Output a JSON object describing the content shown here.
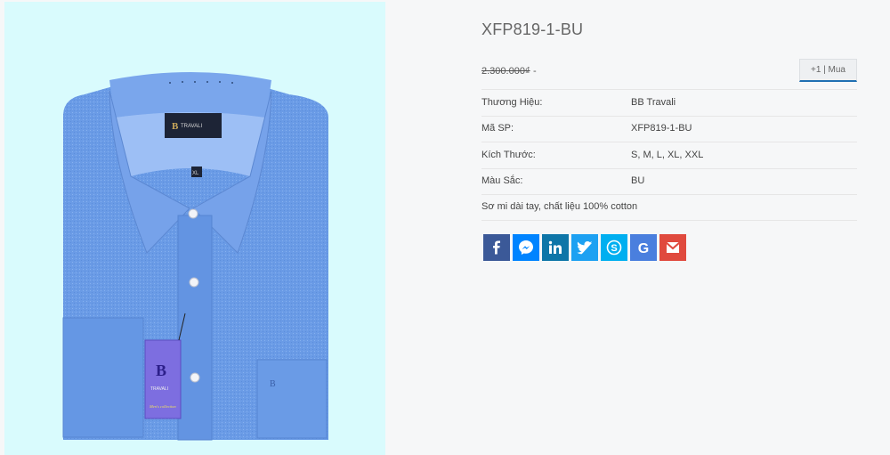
{
  "product": {
    "title": "XFP819-1-BU",
    "price_old": "2.300.000₫",
    "price_sep": "-",
    "buy_label": "+1 | Mua",
    "specs": [
      {
        "label": "Thương Hiệu:",
        "value": "BB Travali"
      },
      {
        "label": "Mã SP:",
        "value": "XFP819-1-BU"
      },
      {
        "label": "Kích Thước:",
        "value": "S, M, L, XL, XXL"
      },
      {
        "label": "Màu Sắc:",
        "value": "BU"
      }
    ],
    "description": "Sơ mi dài tay, chất liệu 100% cotton",
    "image": {
      "brand_label": "TRAVALI",
      "tag_text": "TRAVALI",
      "tag_sub": "Men's collection",
      "collar_size": "XL"
    }
  },
  "share": [
    {
      "icon": "facebook-icon",
      "color": "#3b5998"
    },
    {
      "icon": "messenger-icon",
      "color": "#0084ff"
    },
    {
      "icon": "linkedin-icon",
      "color": "#0e76a8"
    },
    {
      "icon": "twitter-icon",
      "color": "#1da1f2"
    },
    {
      "icon": "skype-icon",
      "color": "#00aff0"
    },
    {
      "icon": "google-icon",
      "color": "#4a7fde"
    },
    {
      "icon": "gmail-icon",
      "color": "#e04a3e"
    }
  ]
}
